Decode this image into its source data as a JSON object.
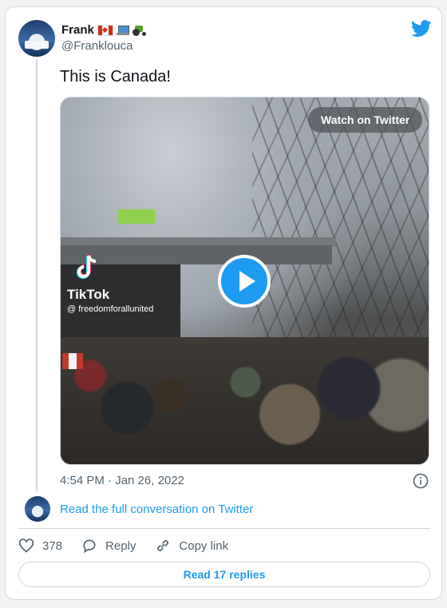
{
  "author": {
    "name": "Frank",
    "emojis": [
      "canada-flag",
      "laptop",
      "tractor"
    ],
    "handle": "@Franklouca"
  },
  "tweet": {
    "text": "This is Canada!",
    "timestamp": "4:54 PM · Jan 26, 2022"
  },
  "media": {
    "watch_label": "Watch on Twitter",
    "tiktok_label": "TikTok",
    "tiktok_user": "@ freedomforallunited",
    "play_icon": "play-icon"
  },
  "conversation": {
    "read_label": "Read the full conversation on Twitter"
  },
  "actions": {
    "likes": "378",
    "reply_label": "Reply",
    "copy_label": "Copy link"
  },
  "footer": {
    "replies_label": "Read 17 replies"
  },
  "colors": {
    "accent": "#1d9bf0",
    "secondary_text": "#536471",
    "border": "#cfd9de"
  }
}
